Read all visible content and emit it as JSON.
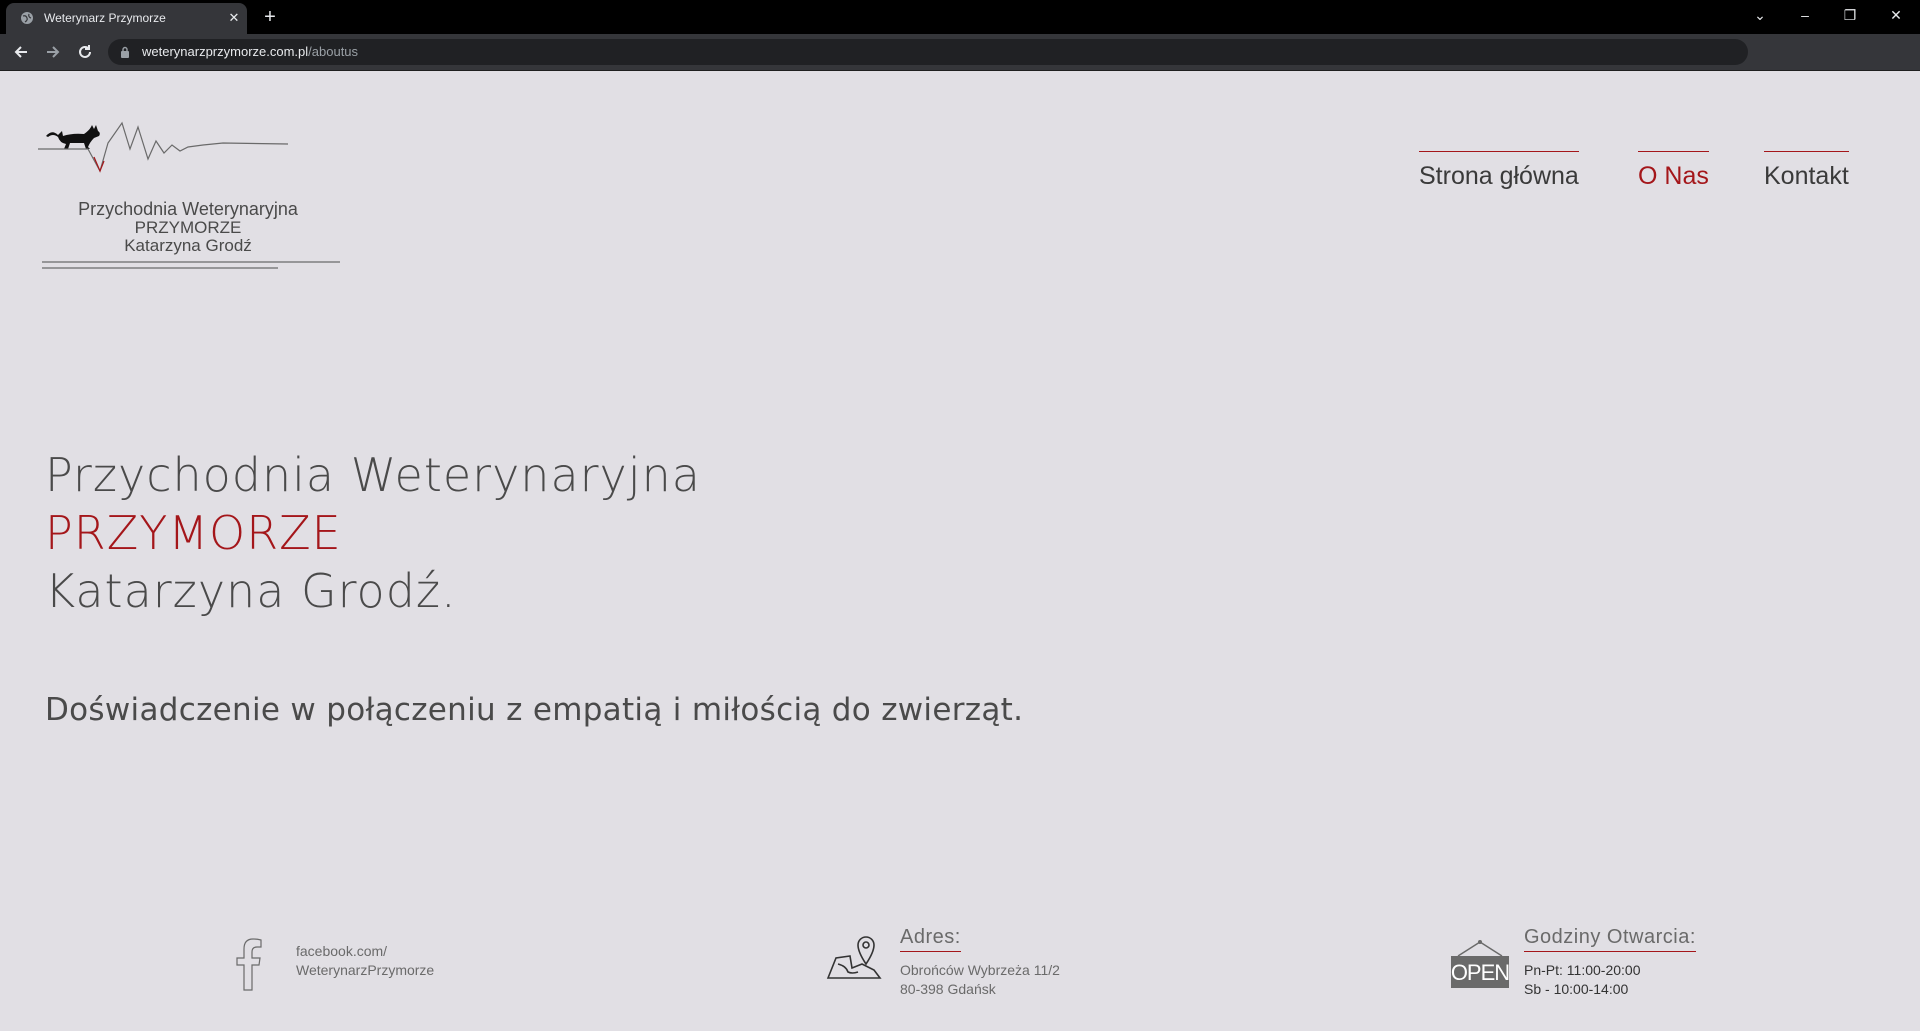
{
  "browser": {
    "tab_title": "Weterynarz Przymorze",
    "url_host": "weterynarzprzymorze.com.pl",
    "url_path": "/aboutus",
    "icons": [
      "globe-icon",
      "close-icon",
      "plus-icon",
      "chevron-down-icon",
      "minimize-icon",
      "restore-icon",
      "close-window-icon",
      "back-icon",
      "forward-icon",
      "reload-icon",
      "lock-icon"
    ]
  },
  "logo": {
    "line1": "Przychodnia Weterynaryjna",
    "line2": "PRZYMORZE",
    "line3": "Katarzyna Grodź"
  },
  "nav": {
    "items": [
      {
        "label": "Strona główna",
        "active": false
      },
      {
        "label": "O Nas",
        "active": true
      },
      {
        "label": "Kontakt",
        "active": false
      }
    ]
  },
  "hero": {
    "line1": "Przychodnia Weterynaryjna",
    "line2": "PRZYMORZE",
    "line3": "Katarzyna Grodź.",
    "tagline": "Doświadczenie w połączeniu z empatią i miłością do zwierząt."
  },
  "footer": {
    "facebook": {
      "line1": "facebook.com/",
      "line2": "WeterynarzPrzymorze"
    },
    "address": {
      "heading": "Adres:",
      "line1": "Obrońców Wybrzeża 11/2",
      "line2": "80-398 Gdańsk"
    },
    "hours": {
      "heading": "Godziny Otwarcia:",
      "line1": "Pn-Pt: 11:00-20:00",
      "line2": "Sb - 10:00-14:00",
      "sign_text": "OPEN"
    }
  },
  "colors": {
    "accent": "#a4161a",
    "background": "#e1dfe4",
    "text": "#4a4a4a"
  }
}
